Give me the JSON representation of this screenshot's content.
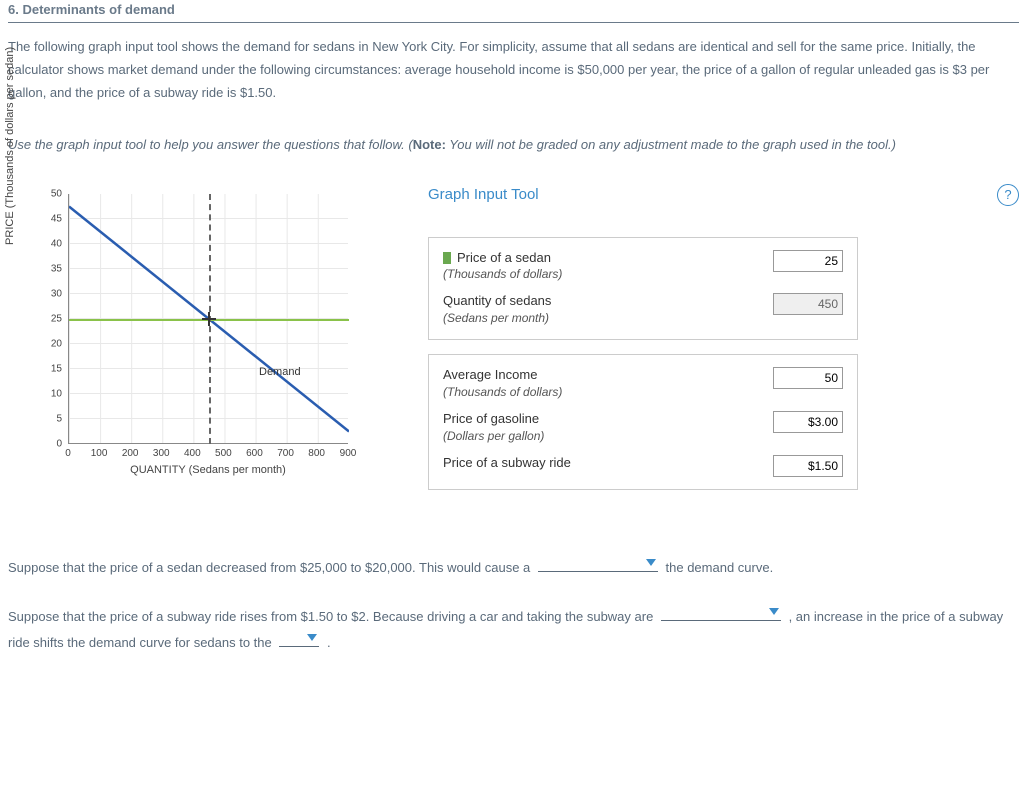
{
  "header": "6. Determinants of demand",
  "intro": "The following graph input tool shows the demand for sedans in New York City. For simplicity, assume that all sedans are identical and sell for the same price. Initially, the calculator shows market demand under the following circumstances: average household income is $50,000 per year, the price of a gallon of regular unleaded gas is $3 per gallon, and the price of a subway ride is $1.50.",
  "note_prefix": "Use the graph input tool to help you answer the questions that follow. (",
  "note_bold": "Note:",
  "note_rest": " You will not be graded on any adjustment made to the graph used in the tool.)",
  "tool": {
    "title": "Graph Input Tool",
    "help": "?",
    "box1": {
      "price_label": "Price of a sedan",
      "price_sub": "(Thousands of dollars)",
      "price_value": "25",
      "qty_label": "Quantity of sedans",
      "qty_sub": "(Sedans per month)",
      "qty_value": "450"
    },
    "box2": {
      "income_label": "Average Income",
      "income_sub": "(Thousands of dollars)",
      "income_value": "50",
      "gas_label": "Price of gasoline",
      "gas_sub": "(Dollars per gallon)",
      "gas_value": "$3.00",
      "subway_label": "Price of a subway ride",
      "subway_value": "$1.50"
    }
  },
  "chart_data": {
    "type": "line",
    "title": "",
    "xlabel": "QUANTITY (Sedans per month)",
    "ylabel": "PRICE (Thousands of dollars per sedan)",
    "xlim": [
      0,
      900
    ],
    "ylim": [
      0,
      50
    ],
    "x_ticks": [
      "0",
      "100",
      "200",
      "300",
      "400",
      "500",
      "600",
      "700",
      "800",
      "900"
    ],
    "y_ticks": [
      "0",
      "5",
      "10",
      "15",
      "20",
      "25",
      "30",
      "35",
      "40",
      "45",
      "50"
    ],
    "series": [
      {
        "name": "Demand",
        "x": [
          0,
          900
        ],
        "y": [
          47.5,
          2.5
        ]
      }
    ],
    "guides": {
      "price": 25,
      "quantity": 450
    },
    "demand_label": "Demand"
  },
  "q1_a": "Suppose that the price of a sedan decreased from $25,000 to $20,000. This would cause a ",
  "q1_b": " the demand curve.",
  "q2_a": "Suppose that the price of a subway ride rises from $1.50 to $2. Because driving a car and taking the subway are ",
  "q2_b": " , an increase in the price of a subway ride shifts the demand curve for sedans to the ",
  "q2_c": " ."
}
